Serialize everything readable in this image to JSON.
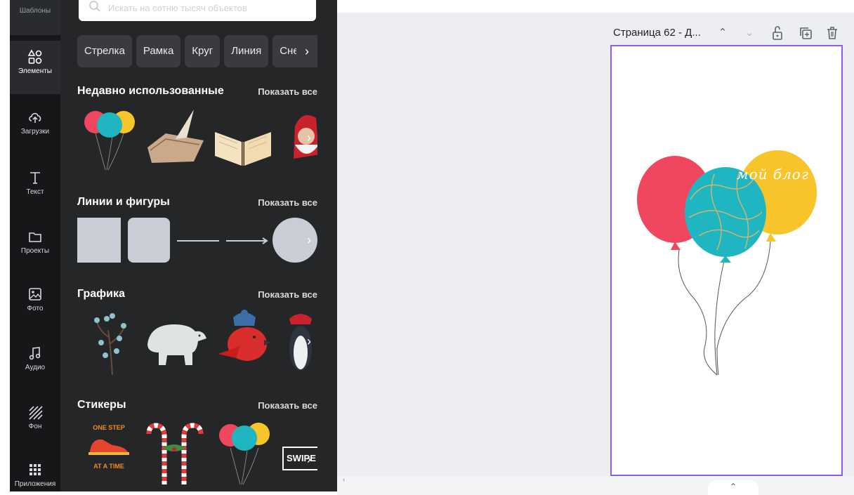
{
  "rail": {
    "top_label": "Шаблоны",
    "items": [
      {
        "label": "Элементы",
        "icon": "shapes-icon"
      },
      {
        "label": "Загрузки",
        "icon": "upload-cloud-icon"
      },
      {
        "label": "Текст",
        "icon": "text-icon"
      },
      {
        "label": "Проекты",
        "icon": "folder-icon"
      },
      {
        "label": "Фото",
        "icon": "photo-icon"
      },
      {
        "label": "Аудио",
        "icon": "music-icon"
      },
      {
        "label": "Фон",
        "icon": "background-pattern-icon"
      },
      {
        "label": "Приложения",
        "icon": "apps-grid-icon"
      }
    ]
  },
  "search": {
    "placeholder": "Искать на сотню тысяч объектов"
  },
  "chips": [
    "Стрелка",
    "Рамка",
    "Круг",
    "Линия",
    "Снежинка"
  ],
  "sections": [
    {
      "title": "Недавно использованные",
      "link": "Показать все"
    },
    {
      "title": "Линии и фигуры",
      "link": "Показать все"
    },
    {
      "title": "Графика",
      "link": "Показать все"
    },
    {
      "title": "Стикеры",
      "link": "Показать все"
    }
  ],
  "stickers": {
    "one_step_line1": "ONE STEP",
    "one_step_line2": "AT A TIME",
    "swipe": "SWIPE"
  },
  "page_header": {
    "title": "Страница 62 - Д..."
  },
  "canvas": {
    "text": "мой блог"
  },
  "colors": {
    "accent": "#8b5cf6",
    "balloon_red": "#f0465f",
    "balloon_teal": "#1fb6c1",
    "balloon_yellow": "#f7c52a"
  }
}
